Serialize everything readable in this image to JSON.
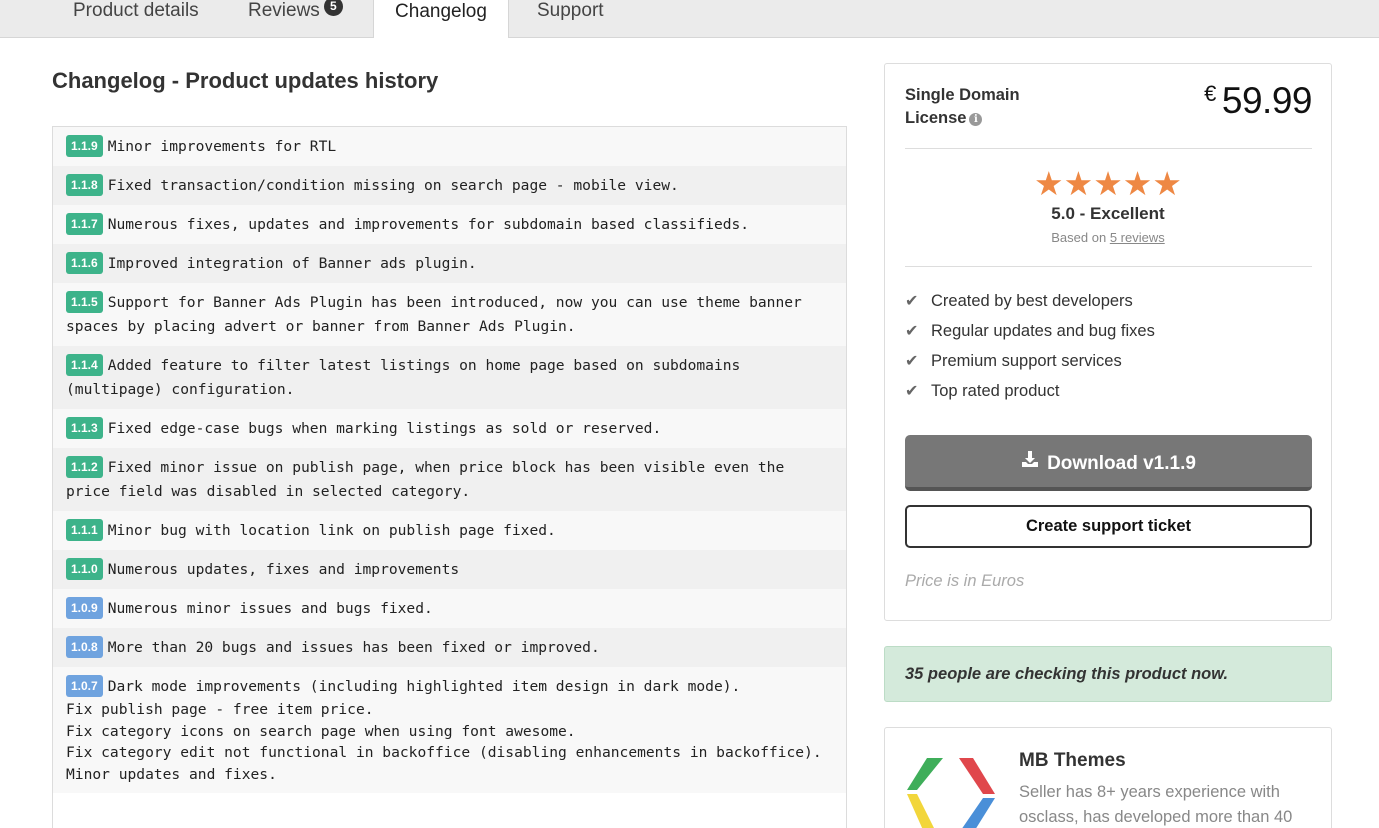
{
  "tabs": [
    {
      "label": "Product details"
    },
    {
      "label": "Reviews",
      "badge": "5"
    },
    {
      "label": "Changelog",
      "active": true
    },
    {
      "label": "Support"
    }
  ],
  "page_title": "Changelog - Product updates history",
  "changelog": [
    {
      "version": "1.1.9",
      "color": "green",
      "text": "Minor improvements for RTL",
      "extra": []
    },
    {
      "version": "1.1.8",
      "color": "green",
      "text": "Fixed transaction/condition missing on search page - mobile view.",
      "extra": []
    },
    {
      "version": "1.1.7",
      "color": "green",
      "text": "Numerous fixes, updates and improvements for subdomain based classifieds.",
      "extra": []
    },
    {
      "version": "1.1.6",
      "color": "green",
      "text": "Improved integration of Banner ads plugin.",
      "extra": []
    },
    {
      "version": "1.1.5",
      "color": "green",
      "text": "Support for Banner Ads Plugin has been introduced, now you can use theme banner spaces by placing advert or banner from Banner Ads Plugin.",
      "extra": []
    },
    {
      "version": "1.1.4",
      "color": "green",
      "text": "Added feature to filter latest listings on home page based on subdomains (multipage) configuration.",
      "extra": []
    },
    {
      "version": "1.1.3",
      "color": "green",
      "text": "Fixed edge-case bugs when marking listings as sold or reserved.",
      "extra": []
    },
    {
      "version": "1.1.2",
      "color": "green",
      "text": "Fixed minor issue on publish page, when price block has been visible even the price field was disabled in selected category.",
      "extra": []
    },
    {
      "version": "1.1.1",
      "color": "green",
      "text": "Minor bug with location link on publish page fixed.",
      "extra": []
    },
    {
      "version": "1.1.0",
      "color": "green",
      "text": "Numerous updates, fixes and improvements",
      "extra": []
    },
    {
      "version": "1.0.9",
      "color": "blue",
      "text": "Numerous minor issues and bugs fixed.",
      "extra": []
    },
    {
      "version": "1.0.8",
      "color": "blue",
      "text": "More than 20 bugs and issues has been fixed or improved.",
      "extra": []
    },
    {
      "version": "1.0.7",
      "color": "blue",
      "text": "Dark mode improvements (including highlighted item design in dark mode).",
      "extra": [
        "Fix publish page - free item price.",
        "Fix category icons on search page when using font awesome.",
        "Fix category edit not functional in backoffice (disabling enhancements in backoffice).",
        "Minor updates and fixes."
      ]
    }
  ],
  "license": {
    "label": "Single Domain License",
    "info_icon": "info-icon",
    "currency": "€",
    "price": "59.99"
  },
  "rating": {
    "stars": 5,
    "max": 5,
    "text": "5.0 - Excellent",
    "based_prefix": "Based on",
    "based_link": "5 reviews",
    "star_color": "#ee8844"
  },
  "features": [
    "Created by best developers",
    "Regular updates and bug fixes",
    "Premium support services",
    "Top rated product"
  ],
  "buttons": {
    "download": "Download v1.1.9",
    "support": "Create support ticket"
  },
  "price_note": "Price is in Euros",
  "alert": "35 people are checking this product now.",
  "seller": {
    "name": "MB Themes",
    "description": "Seller has 8+ years experience with osclass, has developed more than 40"
  },
  "colors": {
    "version_green": "#3db38a",
    "version_blue": "#6fa3df",
    "download_button": "#777777",
    "alert_bg": "#d4eadb"
  }
}
